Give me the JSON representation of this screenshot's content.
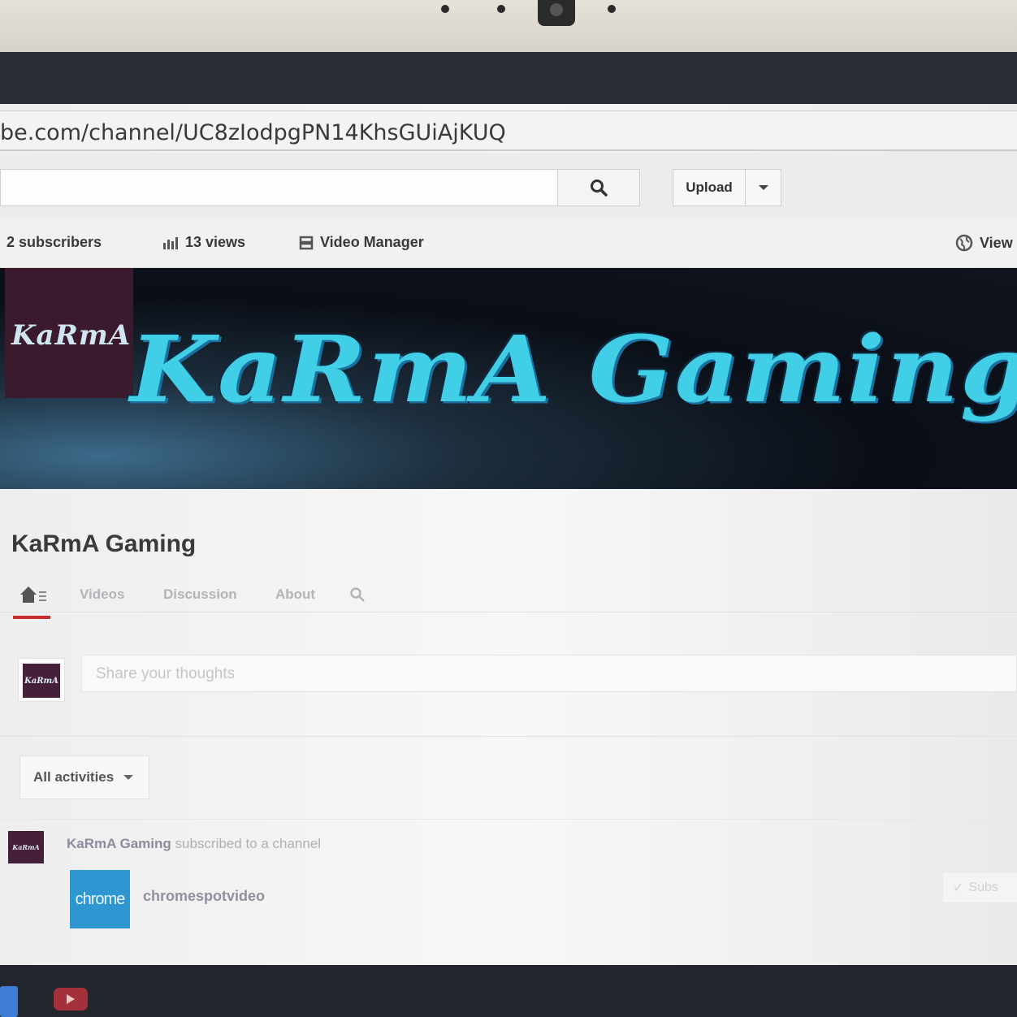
{
  "browser": {
    "url": "be.com/channel/UC8zIodpgPN14KhsGUiAjKUQ"
  },
  "masthead": {
    "search_placeholder": "",
    "upload_label": "Upload"
  },
  "stats": {
    "subscribers": "2 subscribers",
    "views": "13 views",
    "video_manager": "Video Manager",
    "view_as": "View"
  },
  "banner": {
    "avatar_text": "KaRmA",
    "logo_text": "KaRmA Gaming"
  },
  "channel": {
    "title": "KaRmA Gaming",
    "tabs": [
      "Videos",
      "Discussion",
      "About"
    ]
  },
  "share": {
    "placeholder": "Share your thoughts",
    "avatar_text": "KaRmA"
  },
  "feed": {
    "filter_label": "All activities",
    "activity": {
      "actor": "KaRmA Gaming",
      "action": " subscribed to a channel",
      "avatar_text": "KaRmA",
      "channel_thumb_text": "chrome",
      "channel_name": "chromespotvideo",
      "subscribe_label": "Subs"
    }
  },
  "colors": {
    "accent_red": "#cc2b2b",
    "banner_logo": "#40cfe6",
    "chrome_thumb": "#2e97d2"
  }
}
